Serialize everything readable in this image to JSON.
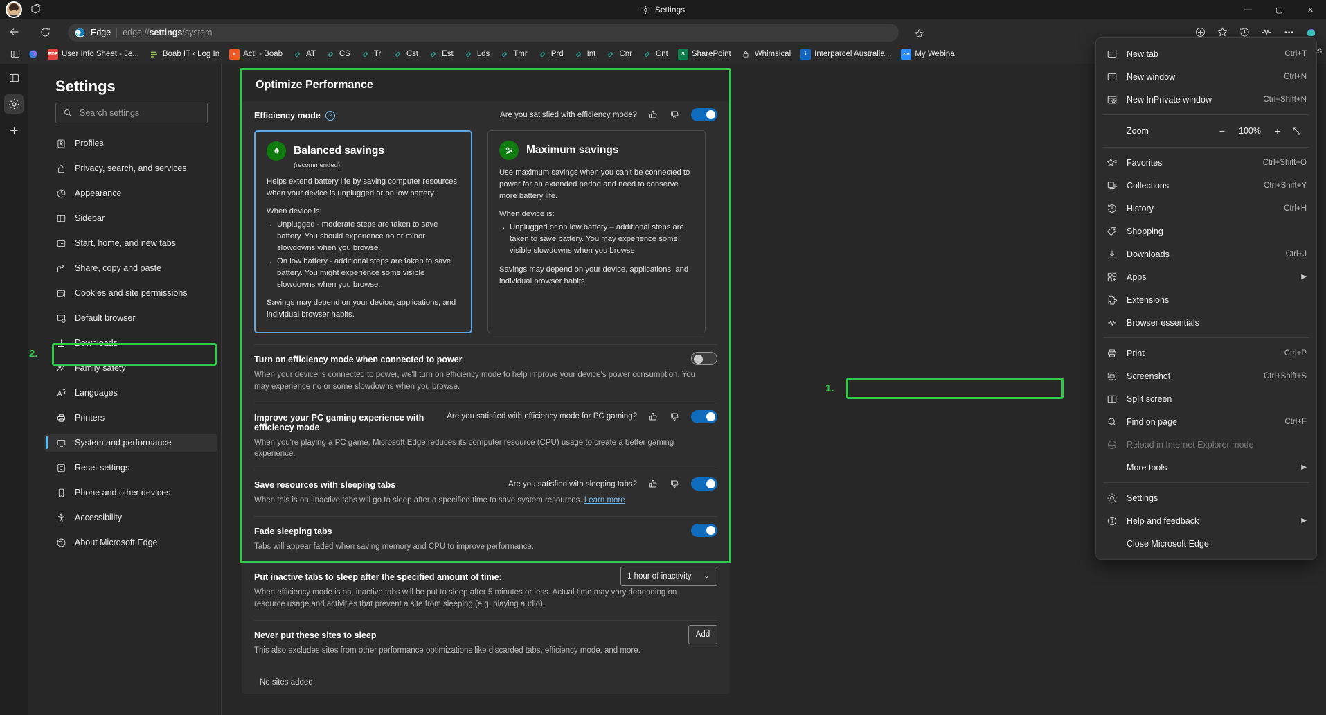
{
  "window": {
    "title": "Settings",
    "minimize": "—",
    "maximize": "▢",
    "close": "✕"
  },
  "toolbar": {
    "back": "back-arrow",
    "refresh": "refresh",
    "brand": "Edge",
    "url_prefix": "edge://",
    "url_bold": "settings",
    "url_suffix": "/system"
  },
  "bookmarks": {
    "items": [
      {
        "label": "User Info Sheet - Je...",
        "icon": "PDF",
        "color": "#ffffff",
        "bg": "#e2443b"
      },
      {
        "label": "Boab IT ‹ Log In",
        "icon": "bars",
        "color": "#8bc34a",
        "bg": "transparent"
      },
      {
        "label": "Act! - Boab",
        "icon": "a",
        "color": "#ffffff",
        "bg": "#f05a22"
      },
      {
        "label": "AT",
        "icon": "link",
        "color": "#2aa198",
        "bg": "transparent"
      },
      {
        "label": "CS",
        "icon": "link",
        "color": "#2aa198",
        "bg": "transparent"
      },
      {
        "label": "Tri",
        "icon": "link",
        "color": "#2aa198",
        "bg": "transparent"
      },
      {
        "label": "Cst",
        "icon": "link",
        "color": "#2aa198",
        "bg": "transparent"
      },
      {
        "label": "Est",
        "icon": "link",
        "color": "#2aa198",
        "bg": "transparent"
      },
      {
        "label": "Lds",
        "icon": "link",
        "color": "#2aa198",
        "bg": "transparent"
      },
      {
        "label": "Tmr",
        "icon": "link",
        "color": "#2aa198",
        "bg": "transparent"
      },
      {
        "label": "Prd",
        "icon": "link",
        "color": "#2aa198",
        "bg": "transparent"
      },
      {
        "label": "Int",
        "icon": "link",
        "color": "#2aa198",
        "bg": "transparent"
      },
      {
        "label": "Cnr",
        "icon": "link",
        "color": "#2aa198",
        "bg": "transparent"
      },
      {
        "label": "Cnt",
        "icon": "link",
        "color": "#2aa198",
        "bg": "transparent"
      },
      {
        "label": "SharePoint",
        "icon": "S",
        "color": "#ffffff",
        "bg": "#0e7c4a"
      },
      {
        "label": "Whimsical",
        "icon": "lock",
        "color": "#cfcfcf",
        "bg": "transparent"
      },
      {
        "label": "Interparcel Australia...",
        "icon": "i",
        "color": "#ffffff",
        "bg": "#1565c0"
      },
      {
        "label": "My Webina",
        "icon": "zm",
        "color": "#ffffff",
        "bg": "#2d8cff"
      }
    ],
    "overflow_label": "orites"
  },
  "settings": {
    "heading": "Settings",
    "search_placeholder": "Search settings",
    "search_value": "",
    "nav": [
      {
        "label": "Profiles",
        "icon": "profile-icon"
      },
      {
        "label": "Privacy, search, and services",
        "icon": "lock-icon"
      },
      {
        "label": "Appearance",
        "icon": "palette-icon"
      },
      {
        "label": "Sidebar",
        "icon": "sidebar-icon"
      },
      {
        "label": "Start, home, and new tabs",
        "icon": "home-icon"
      },
      {
        "label": "Share, copy and paste",
        "icon": "share-icon"
      },
      {
        "label": "Cookies and site permissions",
        "icon": "cookies-icon"
      },
      {
        "label": "Default browser",
        "icon": "default-browser-icon"
      },
      {
        "label": "Downloads",
        "icon": "download-icon"
      },
      {
        "label": "Family safety",
        "icon": "family-icon"
      },
      {
        "label": "Languages",
        "icon": "languages-icon"
      },
      {
        "label": "Printers",
        "icon": "printer-icon"
      },
      {
        "label": "System and performance",
        "icon": "monitor-icon",
        "selected": true
      },
      {
        "label": "Reset settings",
        "icon": "reset-icon"
      },
      {
        "label": "Phone and other devices",
        "icon": "phone-icon"
      },
      {
        "label": "Accessibility",
        "icon": "accessibility-icon"
      },
      {
        "label": "About Microsoft Edge",
        "icon": "edge-icon"
      }
    ]
  },
  "main": {
    "section_title": "Optimize Performance",
    "efficiency": {
      "label": "Efficiency mode",
      "help_glyph": "?",
      "feedback_question": "Are you satisfied with efficiency mode?",
      "thumbs_up": "👍",
      "thumbs_down": "👎",
      "toggle_state": "on"
    },
    "cards": [
      {
        "name": "Balanced savings",
        "recommended": "(recommended)",
        "selected": true,
        "intro": "Helps extend battery life by saving computer resources when your device is unplugged or on low battery.",
        "when_label": "When device is:",
        "bullets": [
          "Unplugged - moderate steps are taken to save battery. You should experience no or minor slowdowns when you browse.",
          "On low battery - additional steps are taken to save battery. You might experience some visible slowdowns when you browse."
        ],
        "footer": "Savings may depend on your device, applications, and individual browser habits."
      },
      {
        "name": "Maximum savings",
        "recommended": "",
        "selected": false,
        "intro": "Use maximum savings when you can't be connected to power for an extended period and need to conserve more battery life.",
        "when_label": "When device is:",
        "bullets": [
          "Unplugged or on low battery – additional steps are taken to save battery. You may experience some visible slowdowns when you browse."
        ],
        "footer": "Savings may depend on your device, applications, and individual browser habits."
      }
    ],
    "rows": [
      {
        "title": "Turn on efficiency mode when connected to power",
        "desc": "When your device is connected to power, we'll turn on efficiency mode to help improve your device's power consumption. You may experience no or some slowdowns when you browse.",
        "control": "toggle",
        "toggle_state": "off",
        "feedback": null
      },
      {
        "title": "Improve your PC gaming experience with efficiency mode",
        "desc": "When you're playing a PC game, Microsoft Edge reduces its computer resource (CPU) usage to create a better gaming experience.",
        "control": "toggle",
        "toggle_state": "on",
        "feedback": "Are you satisfied with efficiency mode for PC gaming?"
      },
      {
        "title": "Save resources with sleeping tabs",
        "desc": "When this is on, inactive tabs will go to sleep after a specified time to save system resources.",
        "link": "Learn more",
        "control": "toggle",
        "toggle_state": "on",
        "feedback": "Are you satisfied with sleeping tabs?"
      },
      {
        "title": "Fade sleeping tabs",
        "desc": "Tabs will appear faded when saving memory and CPU to improve performance.",
        "control": "toggle",
        "toggle_state": "on",
        "feedback": null
      },
      {
        "title": "Put inactive tabs to sleep after the specified amount of time:",
        "desc": "When efficiency mode is on, inactive tabs will be put to sleep after 5 minutes or less. Actual time may vary depending on resource usage and activities that prevent a site from sleeping (e.g. playing audio).",
        "control": "select",
        "select_value": "1 hour of inactivity",
        "feedback": null
      },
      {
        "title": "Never put these sites to sleep",
        "desc": "This also excludes sites from other performance optimizations like discarded tabs, efficiency mode, and more.",
        "control": "button",
        "button_label": "Add",
        "feedback": null
      }
    ],
    "no_sites": "No sites added"
  },
  "menu": {
    "items": [
      {
        "label": "New tab",
        "accel": "Ctrl+T",
        "icon": "new-tab-icon",
        "type": "item"
      },
      {
        "label": "New window",
        "accel": "Ctrl+N",
        "icon": "new-window-icon",
        "type": "item"
      },
      {
        "label": "New InPrivate window",
        "accel": "Ctrl+Shift+N",
        "icon": "inprivate-icon",
        "type": "item"
      },
      {
        "type": "separator"
      },
      {
        "label": "Zoom",
        "zoom_value": "100%",
        "minus": "−",
        "plus": "+",
        "fullscreen": "⤡",
        "type": "zoom"
      },
      {
        "type": "separator"
      },
      {
        "label": "Favorites",
        "accel": "Ctrl+Shift+O",
        "icon": "star-icon",
        "type": "item"
      },
      {
        "label": "Collections",
        "accel": "Ctrl+Shift+Y",
        "icon": "collections-icon",
        "type": "item"
      },
      {
        "label": "History",
        "accel": "Ctrl+H",
        "icon": "history-icon",
        "type": "item"
      },
      {
        "label": "Shopping",
        "accel": "",
        "icon": "shopping-tag-icon",
        "type": "item"
      },
      {
        "label": "Downloads",
        "accel": "Ctrl+J",
        "icon": "download-icon",
        "type": "item"
      },
      {
        "label": "Apps",
        "accel": "",
        "icon": "apps-icon",
        "type": "item",
        "submenu": true
      },
      {
        "label": "Extensions",
        "accel": "",
        "icon": "extensions-icon",
        "type": "item"
      },
      {
        "label": "Browser essentials",
        "accel": "",
        "icon": "heartbeat-icon",
        "type": "item"
      },
      {
        "type": "separator"
      },
      {
        "label": "Print",
        "accel": "Ctrl+P",
        "icon": "printer-icon",
        "type": "item"
      },
      {
        "label": "Screenshot",
        "accel": "Ctrl+Shift+S",
        "icon": "screenshot-icon",
        "type": "item"
      },
      {
        "label": "Split screen",
        "accel": "",
        "icon": "split-screen-icon",
        "type": "item"
      },
      {
        "label": "Find on page",
        "accel": "Ctrl+F",
        "icon": "find-icon",
        "type": "item"
      },
      {
        "label": "Reload in Internet Explorer mode",
        "accel": "",
        "icon": "ie-mode-icon",
        "type": "item",
        "disabled": true
      },
      {
        "label": "More tools",
        "accel": "",
        "icon": "",
        "type": "item",
        "submenu": true,
        "noicon": true
      },
      {
        "type": "separator"
      },
      {
        "label": "Settings",
        "accel": "",
        "icon": "gear-icon",
        "type": "item",
        "highlighted": true
      },
      {
        "label": "Help and feedback",
        "accel": "",
        "icon": "help-icon",
        "type": "item",
        "submenu": true
      },
      {
        "label": "Close Microsoft Edge",
        "accel": "",
        "icon": "",
        "type": "item",
        "noicon": true
      }
    ]
  },
  "annotations": [
    {
      "number": "1.",
      "target": "settings-menu-item"
    },
    {
      "number": "2.",
      "target": "system-and-performance-nav-item"
    }
  ]
}
